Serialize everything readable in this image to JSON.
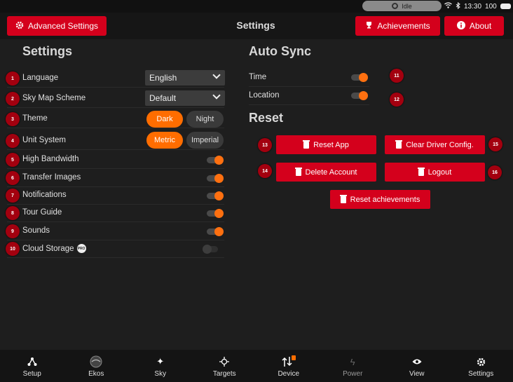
{
  "status": {
    "state": "Idle",
    "time": "13:30",
    "battery": "100"
  },
  "header": {
    "advanced_label": "Advanced Settings",
    "title": "Settings",
    "achievements_label": "Achievements",
    "about_label": "About"
  },
  "settings": {
    "title": "Settings",
    "rows": [
      {
        "badge": "1",
        "label": "Language",
        "value": "English"
      },
      {
        "badge": "2",
        "label": "Sky Map Scheme",
        "value": "Default"
      },
      {
        "badge": "3",
        "label": "Theme",
        "opt_a": "Dark",
        "opt_b": "Night",
        "selected": "Dark"
      },
      {
        "badge": "4",
        "label": "Unit System",
        "opt_a": "Metric",
        "opt_b": "Imperial",
        "selected": "Metric"
      },
      {
        "badge": "5",
        "label": "High Bandwidth",
        "on": true
      },
      {
        "badge": "6",
        "label": "Transfer Images",
        "on": true
      },
      {
        "badge": "7",
        "label": "Notifications",
        "on": true
      },
      {
        "badge": "8",
        "label": "Tour Guide",
        "on": true
      },
      {
        "badge": "9",
        "label": "Sounds",
        "on": true
      },
      {
        "badge": "10",
        "label": "Cloud Storage",
        "pro": "PRO",
        "on": false
      }
    ]
  },
  "autosync": {
    "title": "Auto Sync",
    "rows": [
      {
        "badge": "11",
        "label": "Time",
        "on": true
      },
      {
        "badge": "12",
        "label": "Location",
        "on": true
      }
    ]
  },
  "reset": {
    "title": "Reset",
    "buttons": [
      {
        "badge": "13",
        "label": "Reset App"
      },
      {
        "badge": "15",
        "label": "Clear Driver Config."
      },
      {
        "badge": "14",
        "label": "Delete Account"
      },
      {
        "badge": "16",
        "label": "Logout"
      },
      {
        "label": "Reset achievements"
      }
    ]
  },
  "nav": [
    {
      "label": "Setup",
      "icon": "setup-icon"
    },
    {
      "label": "Ekos",
      "icon": "ekos-icon"
    },
    {
      "label": "Sky",
      "icon": "sky-icon"
    },
    {
      "label": "Targets",
      "icon": "targets-icon"
    },
    {
      "label": "Device",
      "icon": "device-icon"
    },
    {
      "label": "Power",
      "icon": "power-icon"
    },
    {
      "label": "View",
      "icon": "eye-icon"
    },
    {
      "label": "Settings",
      "icon": "gear-icon"
    }
  ],
  "colors": {
    "accent_red": "#d4001c",
    "toggle_orange": "#ff7010",
    "badge_red": "#a3000f"
  }
}
